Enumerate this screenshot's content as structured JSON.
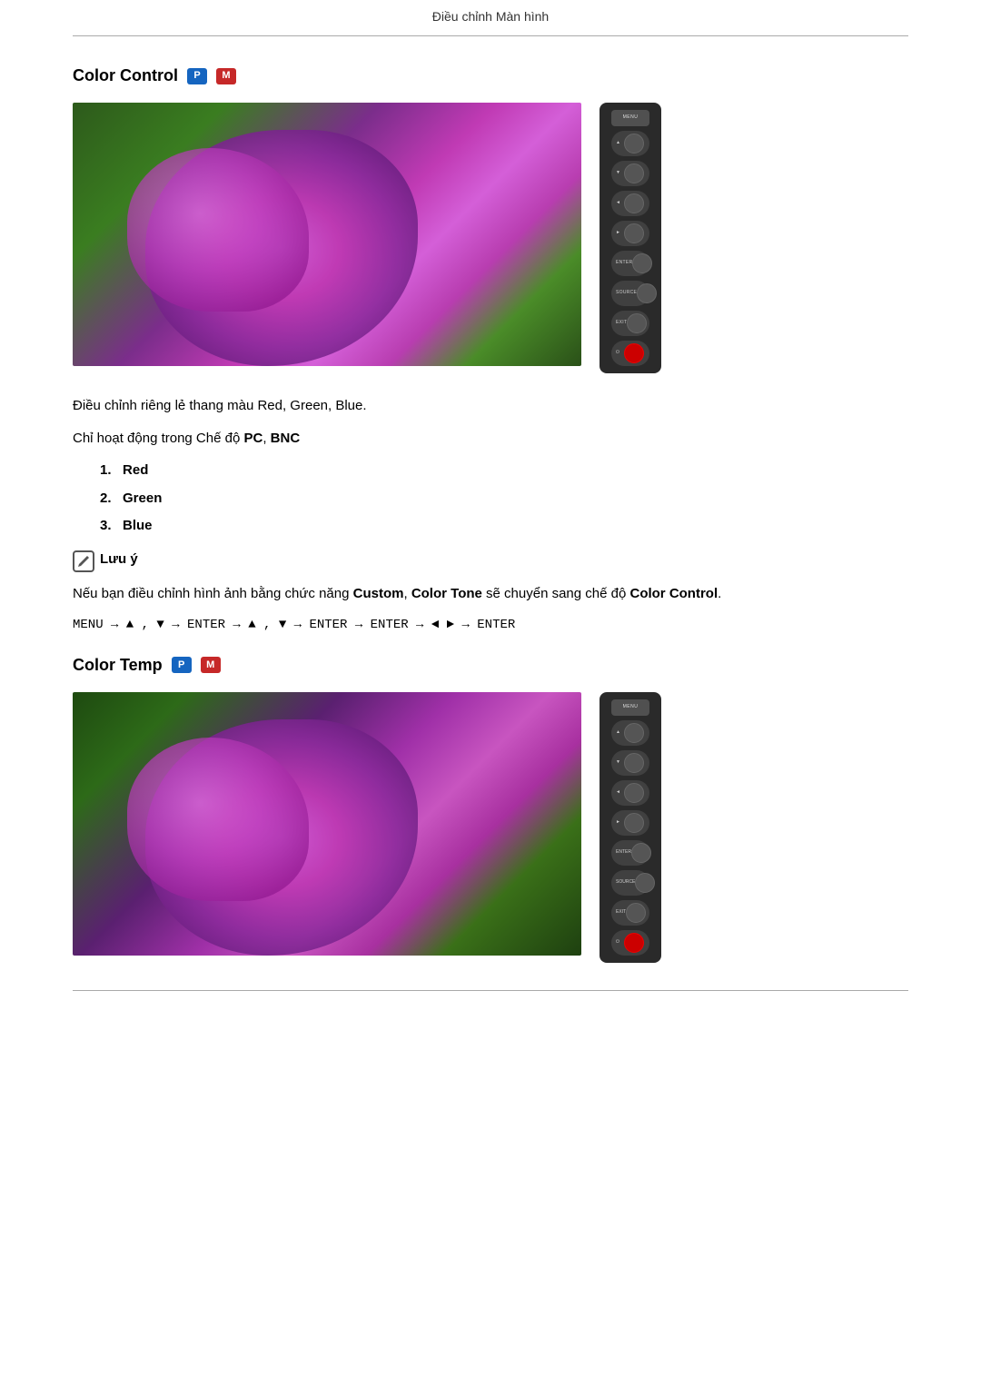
{
  "header": {
    "title": "Điều chỉnh Màn hình"
  },
  "color_control": {
    "section_title": "Color Control",
    "badge_p": "P",
    "badge_m": "M",
    "description1": "Điều chỉnh riêng lẻ thang màu Red, Green, Blue.",
    "description2": "Chỉ hoạt động trong Chế độ ",
    "description2_bold1": "PC",
    "description2_comma": ",",
    "description2_bold2": "BNC",
    "list_items": [
      {
        "num": "1.",
        "label": "Red"
      },
      {
        "num": "2.",
        "label": "Green"
      },
      {
        "num": "3.",
        "label": "Blue"
      }
    ],
    "note_label": "Lưu ý",
    "note_content": "Nếu bạn điều chỉnh hình ảnh bằng chức năng ",
    "note_bold1": "Custom",
    "note_sep1": ", ",
    "note_bold2": "Color Tone",
    "note_mid": " sẽ chuyển sang chế độ ",
    "note_bold3": "Color Control",
    "note_end": ".",
    "menu_path": "MENU → ▲ , ▼ → ENTER → ▲ , ▼ → ENTER → ENTER → ◄ ► → ENTER"
  },
  "color_temp": {
    "section_title": "Color Temp",
    "badge_p": "P",
    "badge_m": "M"
  },
  "remote": {
    "buttons": [
      {
        "label": "MENU",
        "type": "menu"
      },
      {
        "label": "▲",
        "type": "circle"
      },
      {
        "label": "▼",
        "type": "circle"
      },
      {
        "label": "◄",
        "type": "circle"
      },
      {
        "label": "►",
        "type": "circle"
      },
      {
        "label": "ENTER",
        "type": "wide"
      },
      {
        "label": "SOURCE",
        "type": "wide"
      },
      {
        "label": "EXIT",
        "type": "wide"
      },
      {
        "label": "⏻",
        "type": "circle"
      }
    ]
  }
}
